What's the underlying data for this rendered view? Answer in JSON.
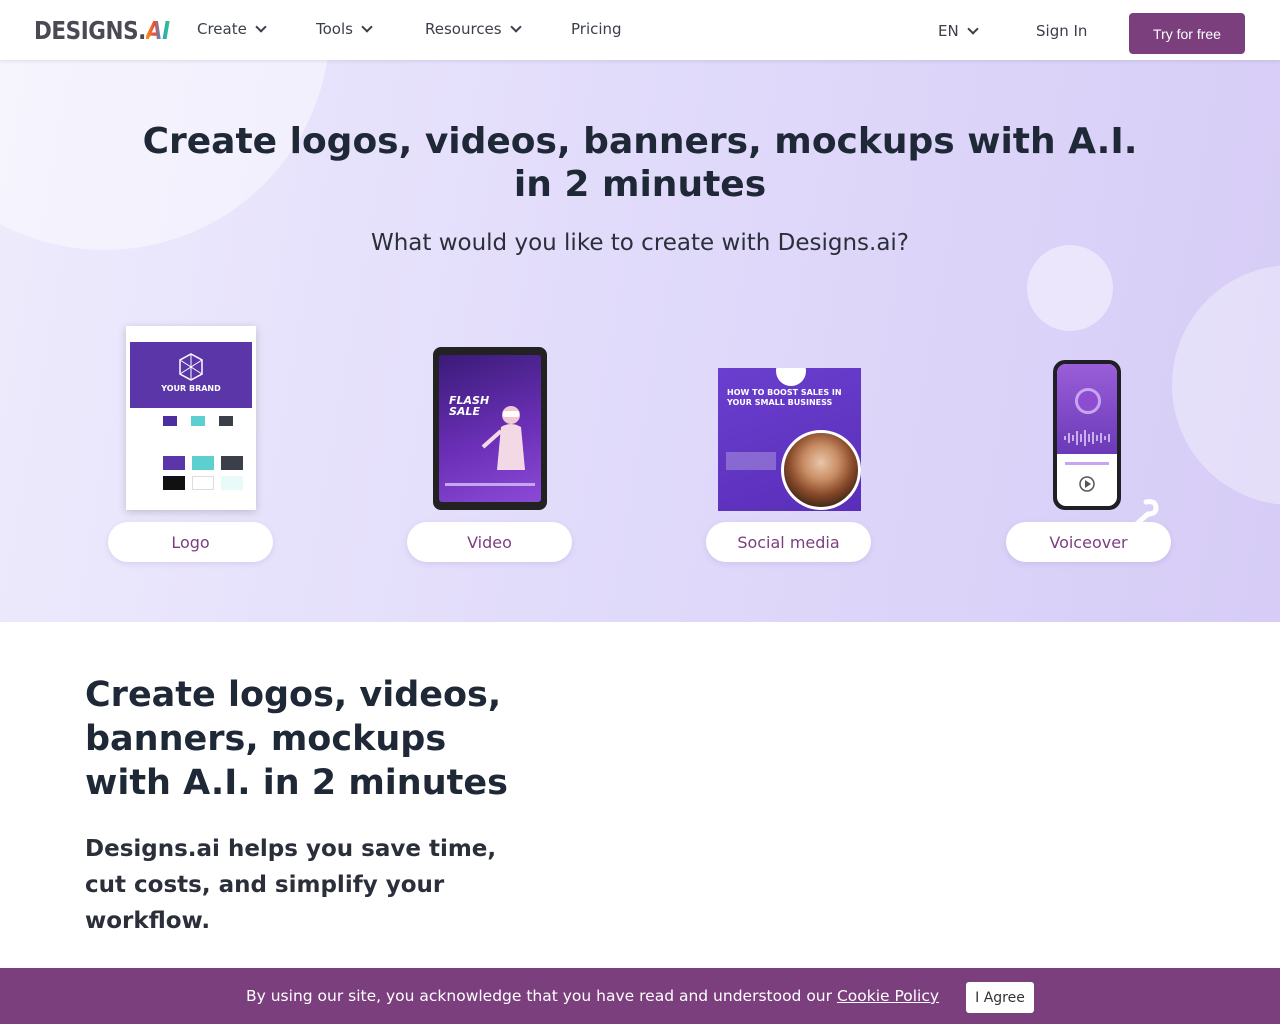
{
  "nav": {
    "logo_text": "DESIGNS.",
    "logo_ai": "AI",
    "items": [
      {
        "label": "Create"
      },
      {
        "label": "Tools"
      },
      {
        "label": "Resources"
      },
      {
        "label": "Pricing"
      }
    ],
    "language": "EN",
    "sign_in": "Sign In",
    "cta": "Try for free"
  },
  "hero": {
    "title": "Create logos, videos, banners, mockups with A.I. in 2 minutes",
    "subtitle": "What would you like to create with Designs.ai?",
    "cards": [
      {
        "label": "Logo"
      },
      {
        "label": "Video"
      },
      {
        "label": "Social media"
      },
      {
        "label": "Voiceover"
      }
    ],
    "mock_text": {
      "logo_brand": "YOUR BRAND",
      "video_flash": "FLASH SALE",
      "social_headline": "HOW TO BOOST SALES IN YOUR SMALL BUSINESS"
    }
  },
  "section2": {
    "title": "Create logos, videos, banners, mockups with A.I. in 2 minutes",
    "subtitle": "Designs.ai helps you save time, cut costs, and simplify your workflow."
  },
  "cookie": {
    "text": "By using our site, you acknowledge that you have read and understood our ",
    "link": "Cookie Policy",
    "button": "I Agree"
  },
  "colors": {
    "brand": "#7b3f7e",
    "hero_bg": "#e2dcfb",
    "text_dark": "#1e2837"
  }
}
